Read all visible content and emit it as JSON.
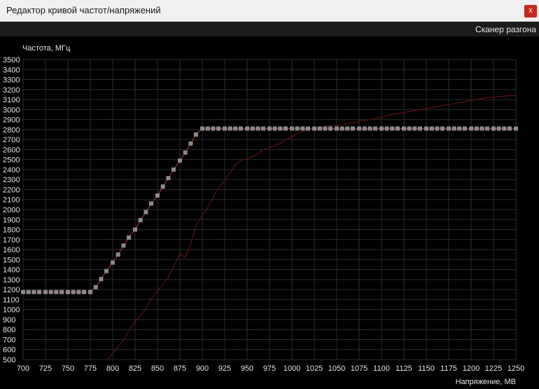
{
  "window": {
    "title": "Редактор кривой частот/напряжений",
    "close_label": "x"
  },
  "toolbar": {
    "scanner_label": "Сканер разгона"
  },
  "chart_data": {
    "type": "line",
    "ylabel": "Частота, МГц",
    "xlabel": "Напряжение, МВ",
    "xlim": [
      700,
      1250
    ],
    "ylim": [
      500,
      3500
    ],
    "x_ticks": [
      700,
      725,
      750,
      775,
      800,
      825,
      850,
      875,
      900,
      925,
      950,
      975,
      1000,
      1025,
      1050,
      1075,
      1100,
      1125,
      1150,
      1175,
      1200,
      1225,
      1250
    ],
    "y_ticks": [
      500,
      600,
      700,
      800,
      900,
      1000,
      1100,
      1200,
      1300,
      1400,
      1500,
      1600,
      1700,
      1800,
      1900,
      2000,
      2100,
      2200,
      2300,
      2400,
      2500,
      2600,
      2700,
      2800,
      2900,
      3000,
      3100,
      3200,
      3300,
      3400,
      3500
    ],
    "grid": true,
    "colors": {
      "curve": "#c0392b",
      "points": "#8a8a8a",
      "reference": "#5a1212",
      "grid": "#2e2e2e"
    },
    "series": [
      {
        "role": "curve",
        "x": [
          700,
          706,
          712,
          718,
          725,
          731,
          737,
          743,
          750,
          756,
          762,
          768,
          775,
          781,
          787,
          793,
          800,
          806,
          812,
          818,
          825,
          831,
          837,
          843,
          850,
          856,
          862,
          868,
          875,
          881,
          887,
          893,
          900,
          906,
          912,
          918,
          925,
          931,
          937,
          943,
          950,
          956,
          962,
          968,
          975,
          981,
          987,
          993,
          1000,
          1006,
          1012,
          1018,
          1025,
          1031,
          1037,
          1043,
          1050,
          1056,
          1062,
          1068,
          1075,
          1081,
          1087,
          1093,
          1100,
          1106,
          1112,
          1118,
          1125,
          1131,
          1137,
          1143,
          1150,
          1156,
          1162,
          1168,
          1175,
          1181,
          1187,
          1193,
          1200,
          1206,
          1212,
          1218,
          1225,
          1231,
          1237,
          1243,
          1250
        ],
        "y": [
          1175,
          1175,
          1175,
          1175,
          1175,
          1175,
          1175,
          1175,
          1175,
          1175,
          1175,
          1175,
          1175,
          1225,
          1305,
          1385,
          1470,
          1550,
          1640,
          1720,
          1800,
          1895,
          1975,
          2060,
          2140,
          2230,
          2315,
          2400,
          2490,
          2570,
          2660,
          2750,
          2810,
          2810,
          2810,
          2810,
          2810,
          2810,
          2810,
          2810,
          2810,
          2810,
          2810,
          2810,
          2810,
          2810,
          2810,
          2810,
          2810,
          2810,
          2810,
          2810,
          2810,
          2810,
          2810,
          2810,
          2810,
          2810,
          2810,
          2810,
          2810,
          2810,
          2810,
          2810,
          2810,
          2810,
          2810,
          2810,
          2810,
          2810,
          2810,
          2810,
          2810,
          2810,
          2810,
          2810,
          2810,
          2810,
          2810,
          2810,
          2810,
          2810,
          2810,
          2810,
          2810,
          2810,
          2810,
          2810,
          2810
        ]
      },
      {
        "role": "reference",
        "x": [
          794,
          800,
          806,
          812,
          818,
          825,
          831,
          837,
          843,
          850,
          856,
          862,
          868,
          875,
          881,
          887,
          893,
          900,
          906,
          912,
          918,
          925,
          931,
          937,
          943,
          950,
          956,
          962,
          968,
          975,
          981,
          987,
          993,
          1000,
          1006,
          1012,
          1018,
          1025,
          1031,
          1037,
          1043,
          1050,
          1056,
          1062,
          1068,
          1075,
          1081,
          1087,
          1093,
          1100,
          1106,
          1112,
          1118,
          1125,
          1131,
          1137,
          1143,
          1150,
          1156,
          1162,
          1168,
          1175,
          1181,
          1187,
          1193,
          1200,
          1206,
          1212,
          1218,
          1225,
          1231,
          1237,
          1243,
          1250
        ],
        "y": [
          500,
          560,
          630,
          690,
          790,
          880,
          940,
          1010,
          1110,
          1190,
          1250,
          1320,
          1430,
          1560,
          1520,
          1660,
          1840,
          1940,
          2020,
          2120,
          2220,
          2290,
          2370,
          2450,
          2490,
          2510,
          2530,
          2560,
          2600,
          2620,
          2640,
          2660,
          2700,
          2730,
          2760,
          2780,
          2800,
          2810,
          2820,
          2830,
          2840,
          2840,
          2850,
          2860,
          2870,
          2880,
          2890,
          2900,
          2910,
          2920,
          2940,
          2950,
          2960,
          2970,
          2980,
          2990,
          3000,
          3010,
          3020,
          3030,
          3040,
          3050,
          3060,
          3070,
          3080,
          3090,
          3100,
          3110,
          3120,
          3125,
          3130,
          3135,
          3140,
          3140
        ]
      }
    ]
  }
}
